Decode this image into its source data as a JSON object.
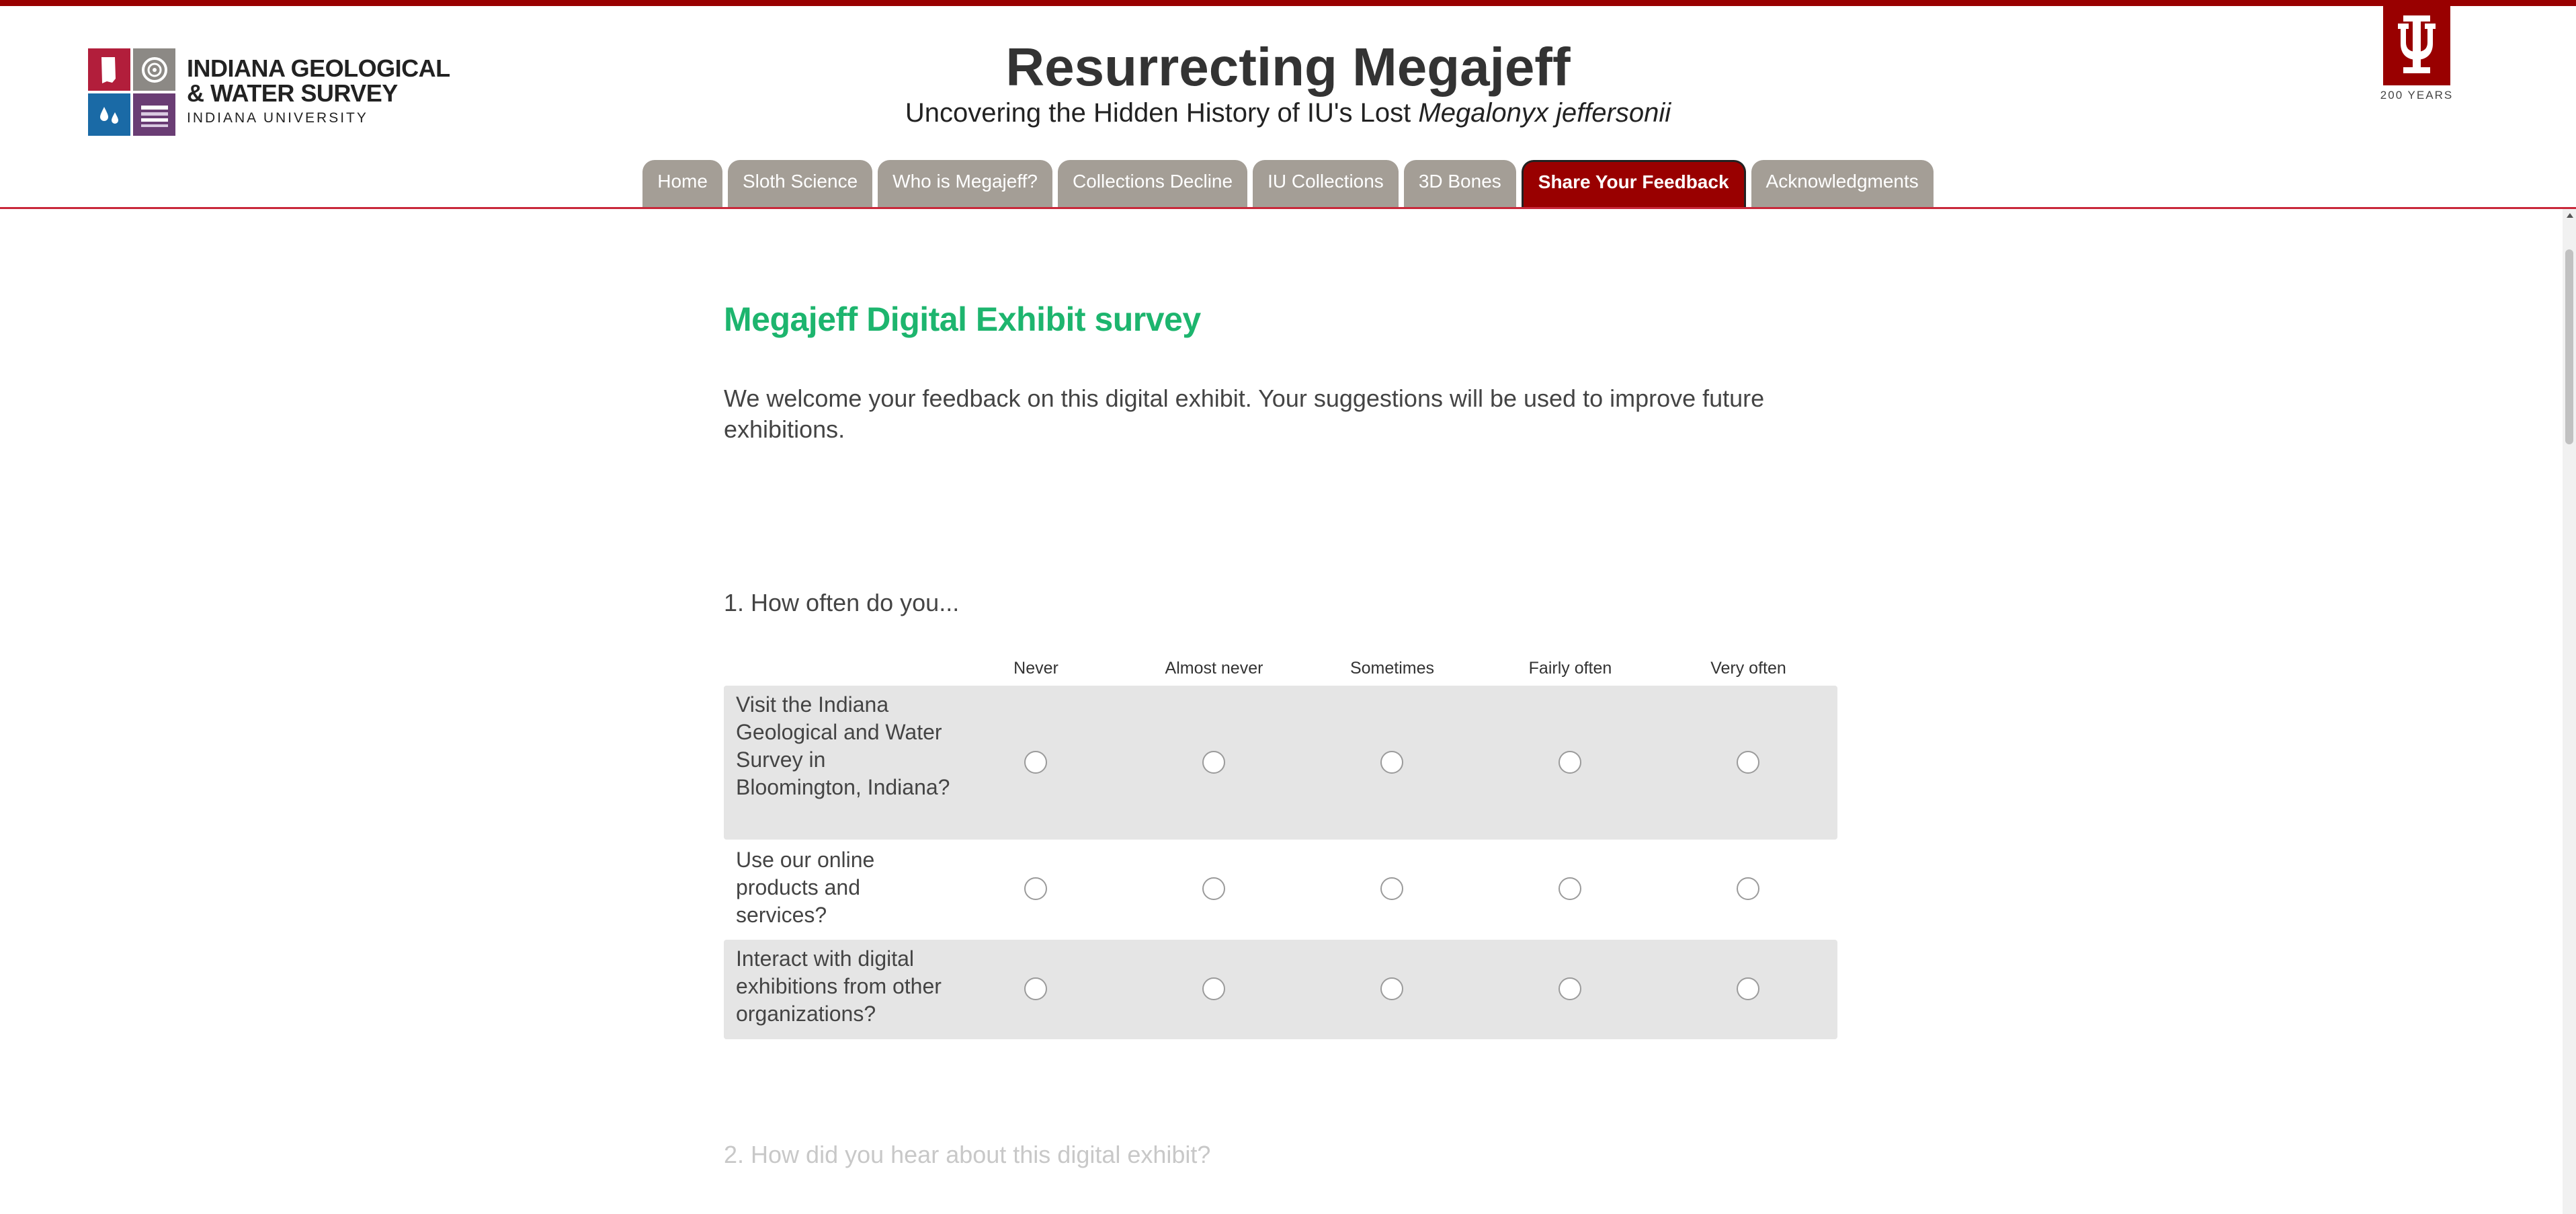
{
  "header": {
    "logo": {
      "line1": "INDIANA GEOLOGICAL",
      "line2": "& WATER SURVEY",
      "line3": "INDIANA UNIVERSITY"
    },
    "title": "Resurrecting Megajeff",
    "subtitle_prefix": "Uncovering the Hidden History of IU's Lost ",
    "subtitle_italic": "Megalonyx jeffersonii",
    "iu_badge_text": "200 YEARS"
  },
  "nav": {
    "tabs": [
      {
        "label": "Home"
      },
      {
        "label": "Sloth Science"
      },
      {
        "label": "Who is Megajeff?"
      },
      {
        "label": "Collections Decline"
      },
      {
        "label": "IU Collections"
      },
      {
        "label": "3D Bones"
      },
      {
        "label": "Share Your Feedback",
        "active": true
      },
      {
        "label": "Acknowledgments"
      }
    ]
  },
  "survey": {
    "title": "Megajeff Digital Exhibit survey",
    "intro": "We welcome your feedback on this digital exhibit. Your suggestions will be used to improve future exhibitions.",
    "question1": {
      "label": "1. How often do you...",
      "columns": [
        "Never",
        "Almost never",
        "Sometimes",
        "Fairly often",
        "Very often"
      ],
      "rows": [
        {
          "label": "Visit the Indiana Geological and Water Survey in Bloomington, Indiana?",
          "selected": null
        },
        {
          "label": "Use our online products and services?",
          "selected": null
        },
        {
          "label": "Interact with digital exhibitions from other organizations?",
          "selected": null
        }
      ]
    },
    "question2": {
      "label": "2. How did you hear about this digital exhibit?"
    }
  },
  "colors": {
    "brand_crimson": "#990000",
    "survey_title_green": "#1db56e",
    "tab_gray": "#a49e96",
    "row_shade": "#e5e5e5"
  }
}
